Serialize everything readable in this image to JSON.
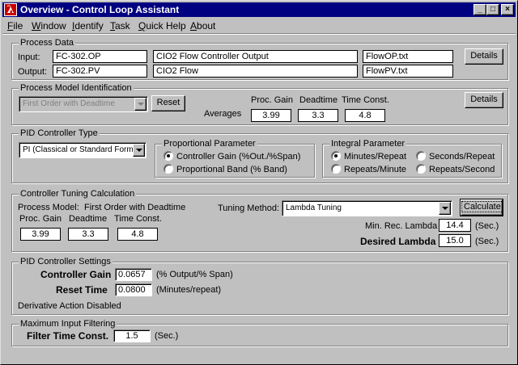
{
  "window": {
    "title": "Overview - Control Loop Assistant",
    "icon_glyph": "λ",
    "controls": {
      "minimize": "_",
      "maximize": "□",
      "close": "×"
    }
  },
  "menu": [
    {
      "label": "File",
      "mnemonic": "F",
      "rest": "ile"
    },
    {
      "label": "Window",
      "mnemonic": "W",
      "rest": "indow"
    },
    {
      "label": "Identify",
      "mnemonic": "I",
      "rest": "dentify"
    },
    {
      "label": "Task",
      "mnemonic": "T",
      "rest": "ask"
    },
    {
      "label": "Quick Help",
      "mnemonic": "Q",
      "rest": "uick Help"
    },
    {
      "label": "About",
      "mnemonic": "A",
      "rest": "bout"
    }
  ],
  "process_data": {
    "title": "Process Data",
    "input_label": "Input:",
    "input_tag": "FC-302.OP",
    "input_desc": "CIO2 Flow Controller Output",
    "input_file": "FlowOP.txt",
    "output_label": "Output:",
    "output_tag": "FC-302.PV",
    "output_desc": "CIO2 Flow",
    "output_file": "FlowPV.txt",
    "details_button": "Details"
  },
  "model_id": {
    "title": "Process Model Identification",
    "model_select": "First Order with Deadtime",
    "reset_button": "Reset",
    "averages_label": "Averages",
    "gain_label": "Proc. Gain",
    "deadtime_label": "Deadtime",
    "timeconst_label": "Time Const.",
    "gain_value": "3.99",
    "deadtime_value": "3.3",
    "timeconst_value": "4.8",
    "details_button": "Details"
  },
  "pid_type": {
    "title": "PID Controller Type",
    "type_select": "PI (Classical or Standard Form)",
    "proportional": {
      "title": "Proportional Parameter",
      "option1": "Controller Gain (%Out./%Span)",
      "option2": "Proportional Band (% Band)",
      "selected": 1
    },
    "integral": {
      "title": "Integral Parameter",
      "option1": "Minutes/Repeat",
      "option2": "Seconds/Repeat",
      "option3": "Repeats/Minute",
      "option4": "Repeats/Second",
      "selected": 1
    }
  },
  "tuning": {
    "title": "Controller Tuning Calculation",
    "process_model_label": "Process Model:",
    "process_model_value": "First Order with Deadtime",
    "gain_label": "Proc. Gain",
    "deadtime_label": "Deadtime",
    "timeconst_label": "Time Const.",
    "gain_value": "3.99",
    "deadtime_value": "3.3",
    "timeconst_value": "4.8",
    "method_label": "Tuning Method:",
    "method_select": "Lambda Tuning",
    "calculate_button": "Calculate",
    "min_lambda_label": "Min. Rec. Lambda",
    "min_lambda_value": "14.4",
    "min_lambda_unit": "(Sec.)",
    "desired_lambda_label": "Desired Lambda",
    "desired_lambda_value": "15.0",
    "desired_lambda_unit": "(Sec.)"
  },
  "settings": {
    "title": "PID Controller Settings",
    "gain_label": "Controller Gain",
    "gain_value": "0.0657",
    "gain_unit": "(% Output/% Span)",
    "reset_label": "Reset Time",
    "reset_value": "0.0800",
    "reset_unit": "(Minutes/repeat)",
    "derivative_note": "Derivative Action Disabled"
  },
  "filtering": {
    "title": "Maximum Input Filtering",
    "filter_label": "Filter Time Const.",
    "filter_value": "1.5",
    "filter_unit": "(Sec.)"
  }
}
